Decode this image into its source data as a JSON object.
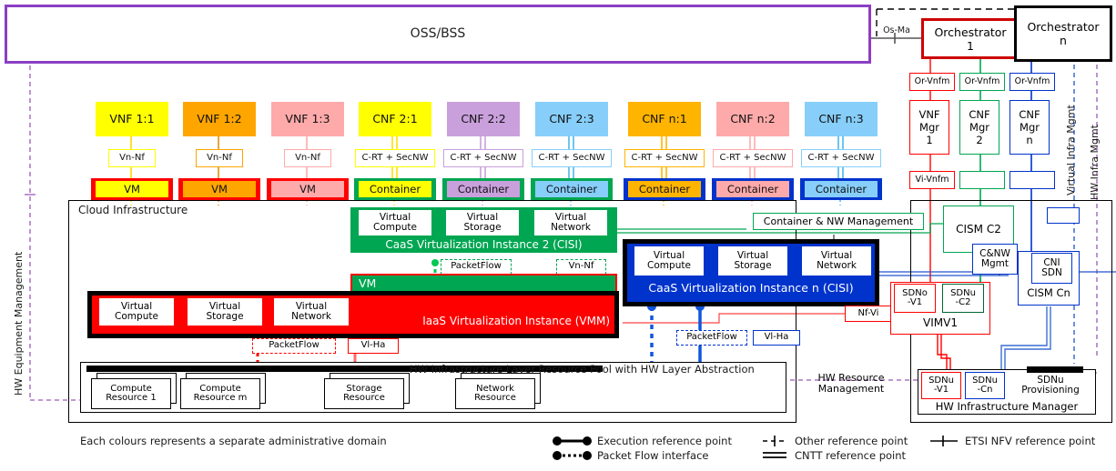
{
  "top": {
    "ossbss": "OSS/BSS",
    "os_ma": "Os-Ma",
    "orchestrator1": "Orchestrator\n1",
    "orchestrator1_l1": "Orchestrator",
    "orchestrator1_l2": "1",
    "orchestratorn_l1": "Orchestrator",
    "orchestratorn_l2": "n"
  },
  "functions": [
    {
      "name": "VNF 1:1",
      "color": "#ffff00",
      "ref": "Vn-Nf",
      "exec": "VM",
      "band": "#ff0000"
    },
    {
      "name": "VNF 1:2",
      "color": "#ffa500",
      "ref": "Vn-Nf",
      "exec": "VM",
      "band": "#ff0000"
    },
    {
      "name": "VNF 1:3",
      "color": "#ffaaaa",
      "ref": "Vn-Nf",
      "exec": "VM",
      "band": "#ff0000"
    },
    {
      "name": "CNF 2:1",
      "color": "#ffff00",
      "ref": "C-RT + SecNW",
      "exec": "Container",
      "band": "#00a651"
    },
    {
      "name": "CNF 2:2",
      "color": "#c9a0dc",
      "ref": "C-RT + SecNW",
      "exec": "Container",
      "band": "#00a651"
    },
    {
      "name": "CNF 2:3",
      "color": "#87cefa",
      "ref": "C-RT + SecNW",
      "exec": "Container",
      "band": "#00a651"
    },
    {
      "name": "CNF n:1",
      "color": "#ffb400",
      "ref": "C-RT + SecNW",
      "exec": "Container",
      "band": "#0033cc"
    },
    {
      "name": "CNF n:2",
      "color": "#ffaaaa",
      "ref": "C-RT + SecNW",
      "exec": "Container",
      "band": "#0033cc"
    },
    {
      "name": "CNF n:3",
      "color": "#87cefa",
      "ref": "C-RT + SecNW",
      "exec": "Container",
      "band": "#0033cc"
    }
  ],
  "managers": {
    "or_vnfm_1": "Or-Vnfm",
    "or_vnfm_2": "Or-Vnfm",
    "or_vnfm_3": "Or-Vnfm",
    "vnf_mgr_1": "VNF\nMgr\n1",
    "vnf_mgr_1_lines": [
      "VNF",
      "Mgr",
      "1"
    ],
    "cnf_mgr_2_lines": [
      "CNF",
      "Mgr",
      "2"
    ],
    "cnf_mgr_n_lines": [
      "CNF",
      "Mgr",
      "n"
    ],
    "vi_vnfm": "Vi-Vnfm",
    "virtual_infra_mgmt": "Virtual Infra Mgmt",
    "hw_infra_mgmt": "HW Infra Mgmt"
  },
  "cloud": {
    "title": "Cloud Infrastructure",
    "hw_equipment_management": "HW Equipment Management",
    "hw_resource_management_l1": "HW Resource",
    "hw_resource_management_l2": "Management",
    "caas2": {
      "title": "CaaS Virtualization Instance 2 (CISI)",
      "resources": [
        "Virtual Compute",
        "Virtual Storage",
        "Virtual Network"
      ],
      "res_lines": [
        [
          "Virtual",
          "Compute"
        ],
        [
          "Virtual",
          "Storage"
        ],
        [
          "Virtual",
          "Network"
        ]
      ]
    },
    "caasn": {
      "title": "CaaS Virtualization Instance n (CISI)",
      "res_lines": [
        [
          "Virtual",
          "Compute"
        ],
        [
          "Virtual",
          "Storage"
        ],
        [
          "Virtual",
          "Network"
        ]
      ]
    },
    "iaas": {
      "title": "IaaS Virtualization Instance (VMM)",
      "res_lines": [
        [
          "Virtual",
          "Compute"
        ],
        [
          "Virtual",
          "Storage"
        ],
        [
          "Virtual",
          "Network"
        ]
      ]
    },
    "vm_band_label": "VM",
    "refs": {
      "packetflow": "PacketFlow",
      "vn_nf": "Vn-Nf",
      "vi_ha": "Vl-Ha",
      "nf_vi": "Nf-Vi"
    },
    "hw_pool_title": "HW Infrastructure Layer Resource Pool with HW Layer Abstraction",
    "hw_resources": [
      {
        "l1": "Compute",
        "l2": "Resource 1"
      },
      {
        "l1": "Compute",
        "l2": "Resource m"
      },
      {
        "l1": "Storage",
        "l2": "Resource"
      },
      {
        "l1": "Network",
        "l2": "Resource"
      }
    ]
  },
  "right": {
    "container_nw_management": "Container & NW Management",
    "cism_c2": "CISM C2",
    "cnw_mgmt_l1": "C&NW",
    "cnw_mgmt_l2": "Mgmt",
    "cni_sdn_l1": "CNI",
    "cni_sdn_l2": "SDN",
    "cism_cn": "CISM Cn",
    "sdno_v1_l1": "SDNo",
    "sdno_v1_l2": "-V1",
    "sdnu_c2_l1": "SDNu",
    "sdnu_c2_l2": "-C2",
    "vimv1": "VIMV1",
    "sdnu_v1_l1": "SDNu",
    "sdnu_v1_l2": "-V1",
    "sdnu_cn_l1": "SDNu",
    "sdnu_cn_l2": "-Cn",
    "sdnu_prov_l1": "SDNu",
    "sdnu_prov_l2": "Provisioning",
    "hw_infra_manager": "HW Infrastructure Manager"
  },
  "legend": {
    "note": "Each colours represents a separate administrative  domain",
    "execution": "Execution reference point",
    "packetflow": "Packet Flow interface",
    "other": "Other reference point",
    "cntt": "CNTT reference point",
    "etsi": "ETSI NFV reference point"
  },
  "colors": {
    "purple": "#8b3fc4",
    "red": "#ff0000",
    "green": "#00a651",
    "blue": "#0033cc",
    "darkred": "#cc0000",
    "dashpurple": "#9b59b6"
  }
}
